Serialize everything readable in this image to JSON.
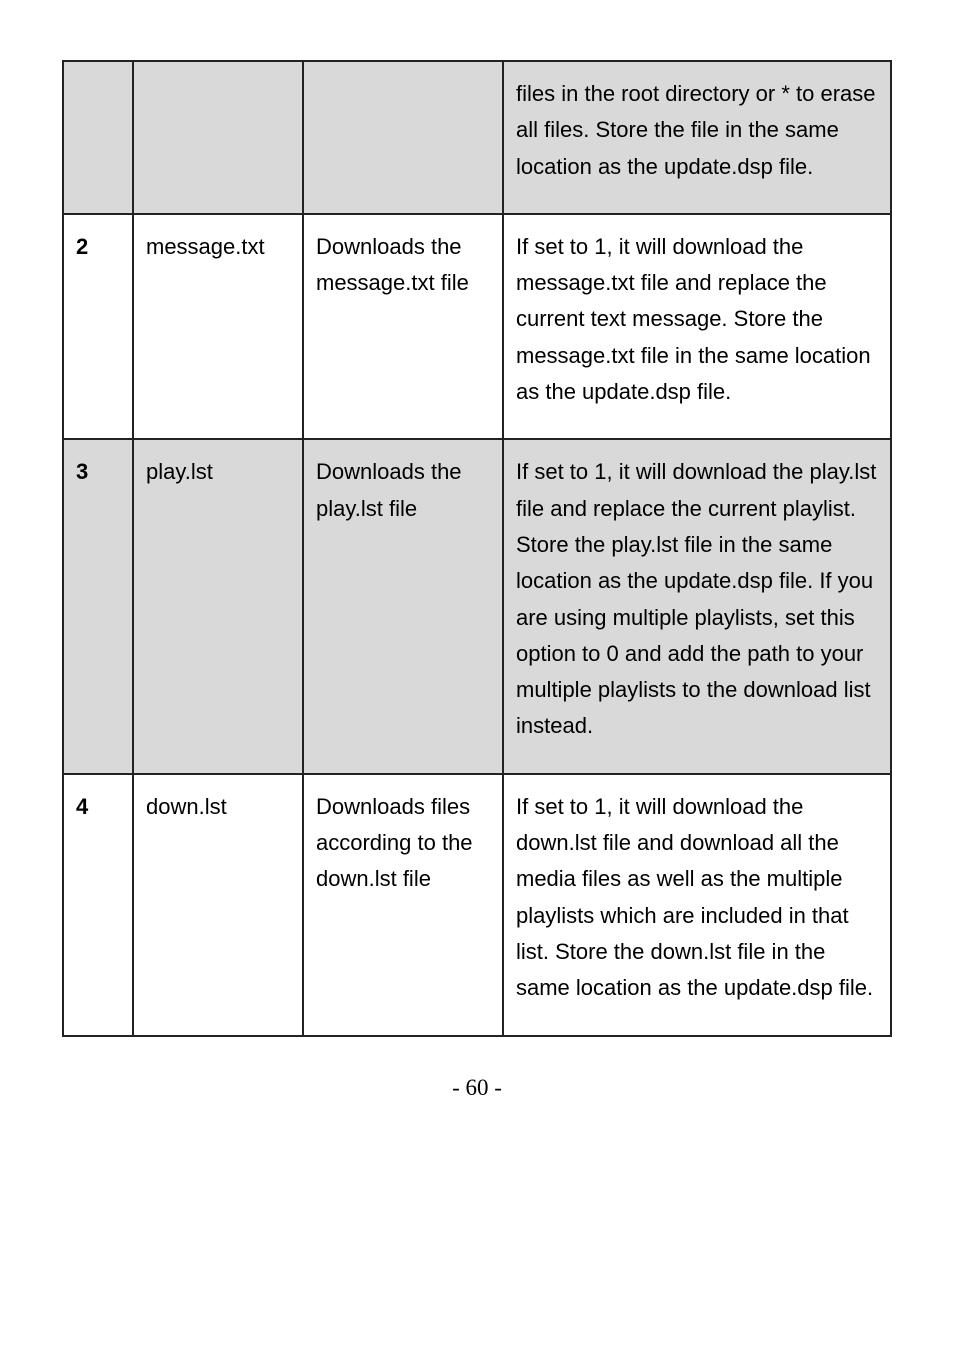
{
  "rows": [
    {
      "shaded": true,
      "c0": "",
      "c1": "",
      "c2": "",
      "c3": "files in the root directory or * to erase all files. Store the file in the same location as the update.dsp file."
    },
    {
      "shaded": false,
      "c0": "2",
      "c1": "message.txt",
      "c2": "Downloads the message.txt file",
      "c3": "If set to 1, it will download the message.txt file and replace the current text message. Store the message.txt file in the same location as the update.dsp file."
    },
    {
      "shaded": true,
      "c0": "3",
      "c1": "play.lst",
      "c2": "Downloads the play.lst file",
      "c3": "If set to 1, it will download the play.lst file and replace the current playlist. Store the play.lst file in the same location as the update.dsp file. If you are using multiple playlists, set this option to 0 and add the path to your multiple playlists to the download list instead."
    },
    {
      "shaded": false,
      "c0": "4",
      "c1": "down.lst",
      "c2": "Downloads files according to the down.lst file",
      "c3": "If set to 1, it will download the down.lst file and download all the media files as well as the multiple playlists which are included in that list. Store the down.lst file in the same location as the update.dsp file."
    }
  ],
  "page_number": "- 60 -"
}
